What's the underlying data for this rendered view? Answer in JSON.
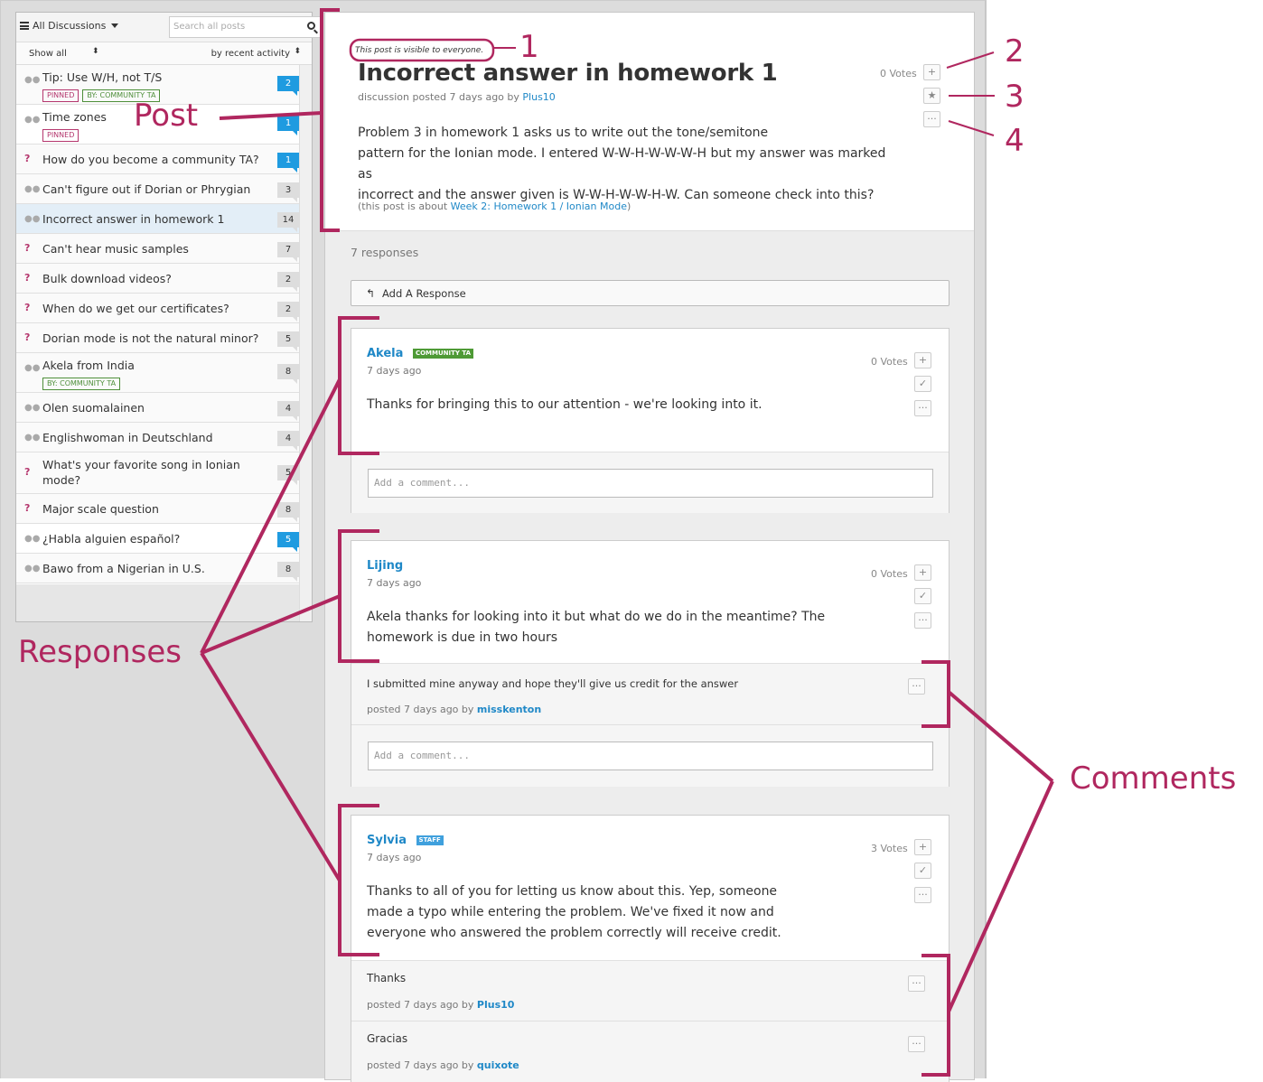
{
  "sidebar": {
    "menu_label": "All Discussions",
    "search_placeholder": "Search all posts",
    "filter_show": "Show all",
    "filter_sort": "by recent activity",
    "threads": [
      {
        "title": "Tip: Use W/H, not T/S",
        "icon": "discussion-icon",
        "count": "2",
        "count_style": "blue",
        "tags": [
          "PINNED",
          "BY: COMMUNITY TA"
        ]
      },
      {
        "title": "Time zones",
        "icon": "discussion-icon",
        "count": "1",
        "count_style": "blue",
        "tags": [
          "PINNED"
        ]
      },
      {
        "title": "How do you become a community TA?",
        "icon": "question-icon",
        "count": "1",
        "count_style": "blue"
      },
      {
        "title": "Can't figure out if Dorian or Phrygian",
        "icon": "discussion-icon",
        "count": "3"
      },
      {
        "title": "Incorrect answer in homework 1",
        "icon": "discussion-icon",
        "count": "14",
        "active": true
      },
      {
        "title": "Can't hear music samples",
        "icon": "question-icon",
        "count": "7"
      },
      {
        "title": "Bulk download videos?",
        "icon": "question-icon",
        "count": "2"
      },
      {
        "title": "When do we get our certificates?",
        "icon": "question-icon",
        "count": "2"
      },
      {
        "title": "Dorian mode is not the natural minor?",
        "icon": "question-icon",
        "count": "5"
      },
      {
        "title": "Akela from India",
        "icon": "discussion-icon",
        "count": "8",
        "tags": [
          "BY: COMMUNITY TA"
        ]
      },
      {
        "title": "Olen suomalainen",
        "icon": "discussion-icon",
        "count": "4"
      },
      {
        "title": "Englishwoman in Deutschland",
        "icon": "discussion-icon",
        "count": "4"
      },
      {
        "title": "What's your favorite song in Ionian mode?",
        "icon": "question-icon",
        "count": "5"
      },
      {
        "title": "Major scale question",
        "icon": "question-icon",
        "count": "8"
      },
      {
        "title": "¿Habla alguien español?",
        "icon": "discussion-icon",
        "count": "5",
        "count_style": "blue"
      },
      {
        "title": "Bawo from a Nigerian in U.S.",
        "icon": "discussion-icon",
        "count": "8"
      }
    ]
  },
  "post": {
    "visibility": "This post is visible to everyone.",
    "title": "Incorrect answer in homework 1",
    "meta_prefix": "discussion posted 7 days ago by",
    "author": "Plus10",
    "votes": "0 Votes",
    "body_line1": "Problem 3 in homework 1 asks us to write out the tone/semitone",
    "body_line2": "pattern for the Ionian mode. I entered W-W-H-W-W-W-H but my answer was marked as",
    "body_line3": "incorrect and the answer given is W-W-H-W-W-H-W. Can someone check into this?",
    "about_prefix": "(this post is about",
    "about_link": "Week 2: Homework 1 / Ionian Mode",
    "about_suffix": ")"
  },
  "responses_count": "7 responses",
  "add_response_label": "Add A Response",
  "comment_placeholder": "Add a comment...",
  "responses": [
    {
      "author": "Akela",
      "badge": "COMMUNITY TA",
      "date": "7 days ago",
      "votes": "0 Votes",
      "body": "Thanks for bringing this to our attention - we're looking into it.",
      "comments": []
    },
    {
      "author": "Lijing",
      "date": "7 days ago",
      "votes": "0 Votes",
      "body_line1": "Akela thanks for looking into it but what do we do in  the meantime? The",
      "body_line2": "homework is due in two hours",
      "comments": [
        {
          "text": "I submitted mine anyway and hope they'll give us credit for the answer",
          "meta": "posted 7 days ago by",
          "author": "misskenton"
        }
      ]
    },
    {
      "author": "Sylvia",
      "badge": "STAFF",
      "date": "7 days ago",
      "votes": "3 Votes",
      "body_line1": "Thanks to all of you for letting us know about this. Yep, someone",
      "body_line2": "made a typo while entering the problem. We've fixed it now and",
      "body_line3": "everyone who answered the problem correctly will receive credit.",
      "comments": [
        {
          "text": "Thanks",
          "meta": "posted 7 days ago by",
          "author": "Plus10"
        },
        {
          "text": "Gracias",
          "meta": "posted 7 days ago by",
          "author": "quixote"
        }
      ]
    }
  ],
  "annotations": {
    "n1": "1",
    "n2": "2",
    "n3": "3",
    "n4": "4",
    "post": "Post",
    "responses": "Responses",
    "comments": "Comments",
    "color": "#b0275f"
  }
}
